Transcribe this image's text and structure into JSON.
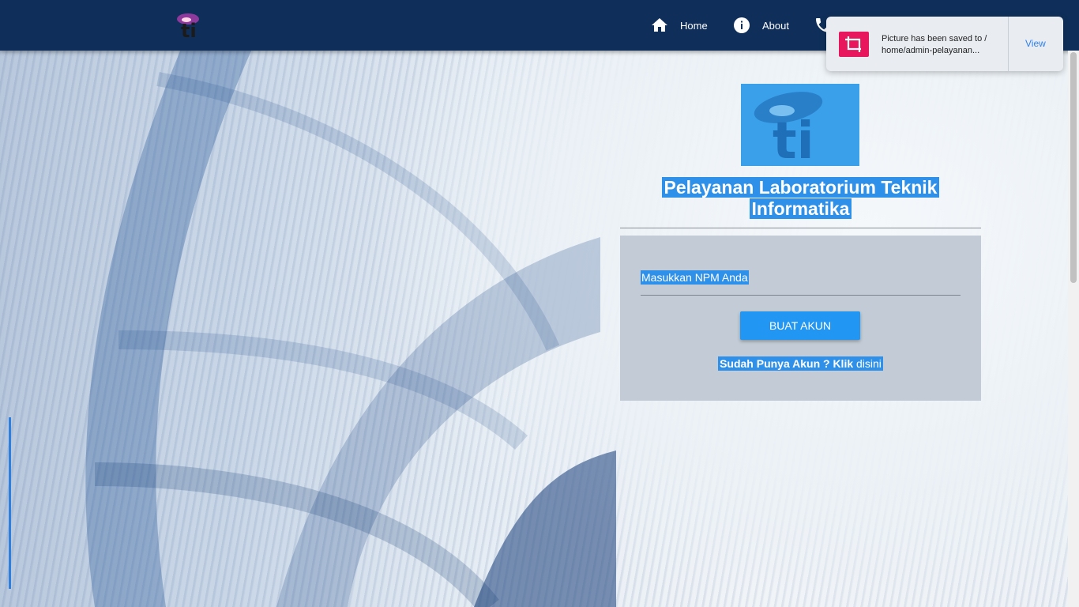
{
  "nav": {
    "items": [
      {
        "label": "Home",
        "icon": "home-icon"
      },
      {
        "label": "About",
        "icon": "info-icon"
      },
      {
        "label": "",
        "icon": "phone-icon"
      }
    ]
  },
  "toast": {
    "message": "Picture has been saved to / home/admin-pelayanan...",
    "action": "View",
    "icon": "crop-icon"
  },
  "main": {
    "title_line1": "Pelayanan Laboratorium Teknik",
    "title_line2": "Informatika",
    "npm_placeholder": "Masukkan NPM Anda",
    "create_button": "BUAT AKUN",
    "login_prefix": "Sudah Punya Akun ? Klik",
    "login_link": "disini"
  },
  "colors": {
    "topbar": "#0f2f5a",
    "accent": "#2196f3",
    "panel": "#c3ccd6",
    "toast_icon": "#e8175d"
  }
}
